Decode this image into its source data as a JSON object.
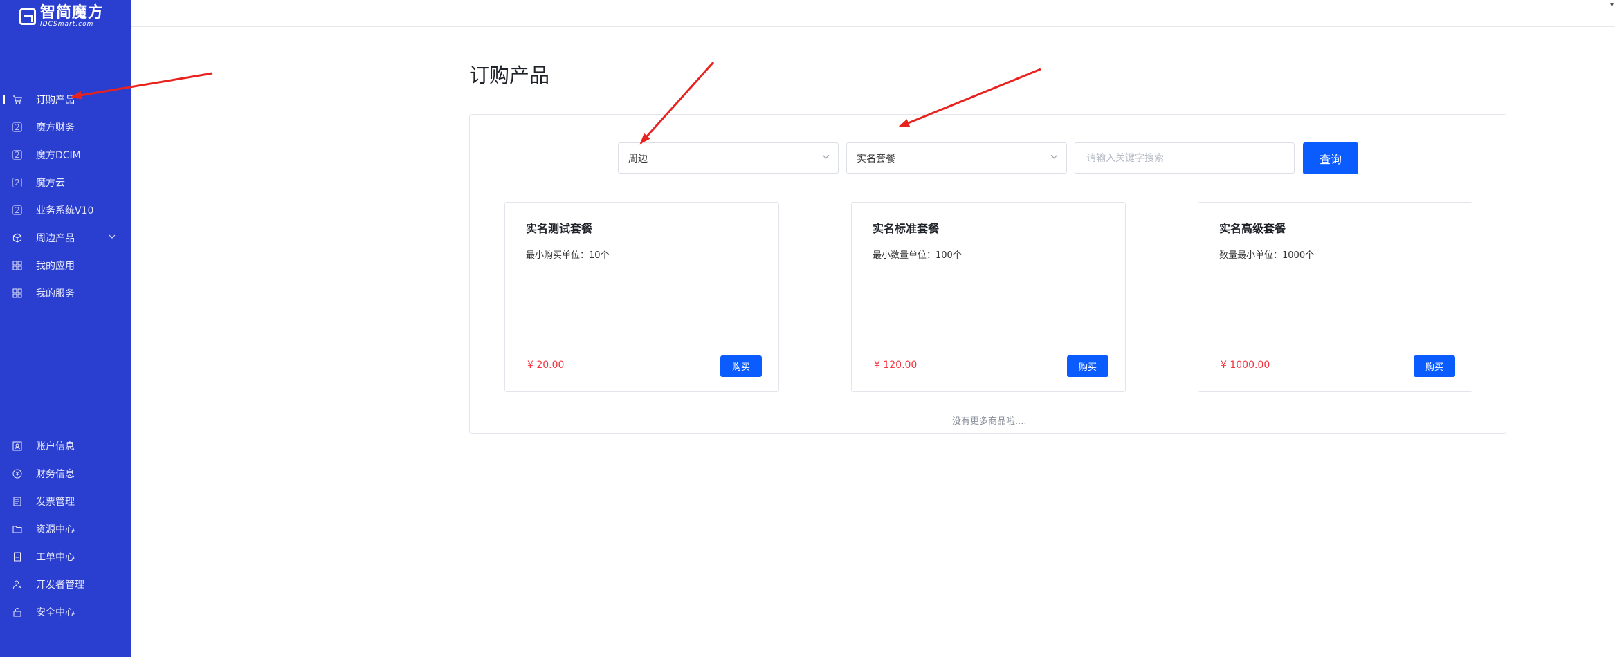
{
  "brand": {
    "name_cn": "智简魔方",
    "name_en": "IDCSmart.com"
  },
  "sidebar": {
    "top_items": [
      {
        "label": "订购产品",
        "icon": "cart-icon",
        "active": true
      },
      {
        "label": "魔方财务",
        "icon": "mofang-icon"
      },
      {
        "label": "魔方DCIM",
        "icon": "mofang-icon"
      },
      {
        "label": "魔方云",
        "icon": "mofang-icon"
      },
      {
        "label": "业务系统V10",
        "icon": "mofang-icon"
      },
      {
        "label": "周边产品",
        "icon": "cube-icon",
        "expandable": true
      },
      {
        "label": "我的应用",
        "icon": "grid-icon"
      },
      {
        "label": "我的服务",
        "icon": "grid-icon"
      }
    ],
    "bottom_items": [
      {
        "label": "账户信息",
        "icon": "account-icon"
      },
      {
        "label": "财务信息",
        "icon": "finance-icon"
      },
      {
        "label": "发票管理",
        "icon": "invoice-icon"
      },
      {
        "label": "资源中心",
        "icon": "folder-icon"
      },
      {
        "label": "工单中心",
        "icon": "ticket-icon"
      },
      {
        "label": "开发者管理",
        "icon": "developer-icon"
      },
      {
        "label": "安全中心",
        "icon": "lock-icon"
      }
    ]
  },
  "main": {
    "title": "订购产品",
    "filters": {
      "category_selected": "周边",
      "package_selected": "实名套餐",
      "search_placeholder": "请输入关键字搜索",
      "search_value": "",
      "query_label": "查询"
    },
    "products": [
      {
        "name": "实名测试套餐",
        "desc": "最小购买单位：10个",
        "price": "¥ 20.00",
        "buy_label": "购买"
      },
      {
        "name": "实名标准套餐",
        "desc": "最小数量单位：100个",
        "price": "¥ 120.00",
        "buy_label": "购买"
      },
      {
        "name": "实名高级套餐",
        "desc": "数量最小单位：1000个",
        "price": "¥ 1000.00",
        "buy_label": "购买"
      }
    ],
    "no_more_text": "没有更多商品啦...."
  },
  "colors": {
    "sidebar_bg": "#2a3fd0",
    "primary": "#0b5cff",
    "price": "#f5333f",
    "annotation_arrow": "#e8231f"
  }
}
